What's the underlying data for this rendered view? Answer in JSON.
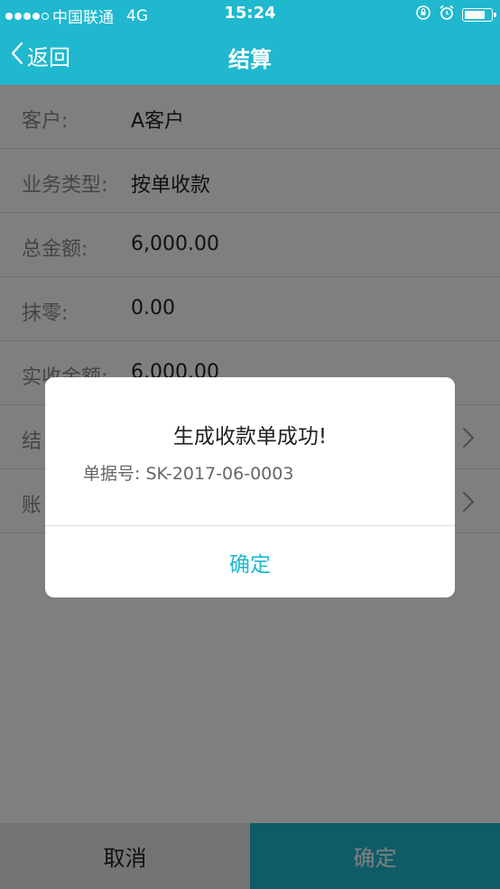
{
  "status_bar": {
    "carrier": "中国联通",
    "network": "4G",
    "time": "15:24"
  },
  "nav": {
    "back_label": "返回",
    "title": "结算"
  },
  "form": {
    "rows": [
      {
        "label": "客户:",
        "value": "A客户",
        "chevron": false
      },
      {
        "label": "业务类型:",
        "value": "按单收款",
        "chevron": false
      },
      {
        "label": "总金额:",
        "value": "6,000.00",
        "chevron": false
      },
      {
        "label": "抹零:",
        "value": "0.00",
        "chevron": false
      },
      {
        "label": "实收金额:",
        "value": "6,000.00",
        "chevron": false
      },
      {
        "label": "结",
        "value": "",
        "chevron": true
      },
      {
        "label": "账",
        "value": "",
        "chevron": true
      }
    ]
  },
  "bottom_bar": {
    "cancel_label": "取消",
    "confirm_label": "确定"
  },
  "dialog": {
    "title": "生成收款单成功!",
    "doc_label": "单据号:",
    "doc_number": "SK-2017-06-0003",
    "ok_label": "确定"
  },
  "colors": {
    "accent": "#1fb8cf"
  },
  "icons": {
    "back": "chevron-left-icon",
    "row_arrow": "chevron-right-icon",
    "lock": "orientation-lock-icon",
    "alarm": "alarm-icon",
    "battery": "battery-icon"
  }
}
